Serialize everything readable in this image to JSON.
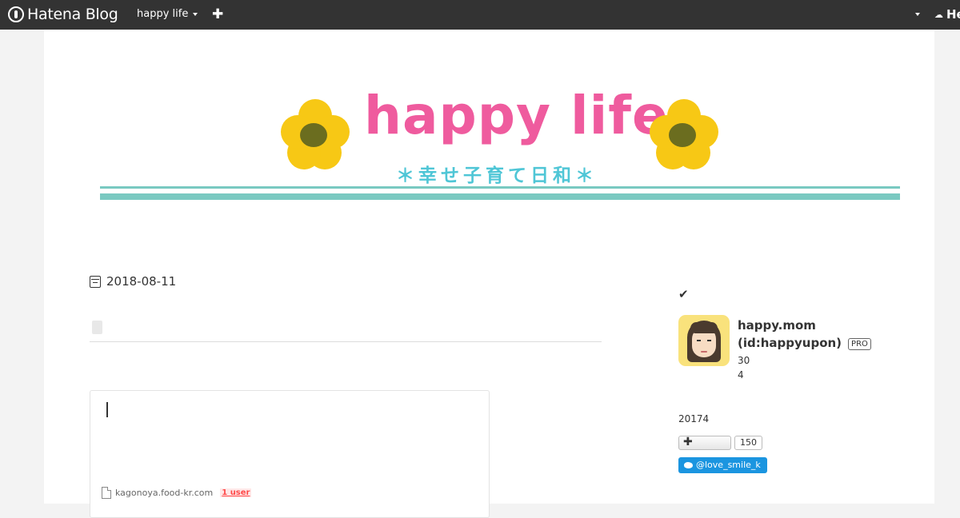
{
  "topbar": {
    "brand": "Hatena Blog",
    "blog_name": "happy life",
    "right_logo": "He"
  },
  "banner": {
    "title": "happy life",
    "subtitle": "＊幸せ子育て日和＊"
  },
  "post": {
    "date": "2018-08-11",
    "embed_domain": "kagonoya.food-kr.com",
    "embed_users": "1 user"
  },
  "sidebar": {
    "name_line1": "happy.mom",
    "name_line2": "(id:happyupon)",
    "pro_label": "PRO",
    "stat1": "30",
    "stat2": "4",
    "since": "20174",
    "subscribe_count": "150",
    "twitter_handle": "@love_smile_k"
  },
  "colors": {
    "topbar": "#333333",
    "banner_title": "#ef5b9e",
    "banner_subtitle": "#4fc6d6",
    "flower": "#f7c815",
    "stripe": "#79c9c1",
    "twitter": "#1b95e0"
  }
}
